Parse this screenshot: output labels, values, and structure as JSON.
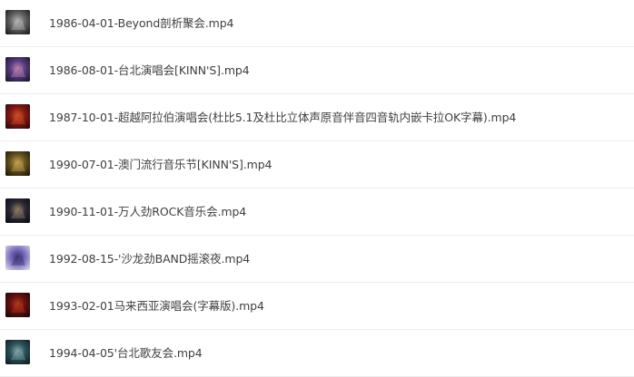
{
  "files": [
    {
      "name": "1986-04-01-Beyond剖析聚会.mp4",
      "thumb_icon": "video-thumbnail-icon",
      "thumb_colors": [
        "#1a1a1a",
        "#6b6b6b",
        "#c9c9c9"
      ]
    },
    {
      "name": "1986-08-01-台北演唱会[KINN'S].mp4",
      "thumb_icon": "video-thumbnail-icon",
      "thumb_colors": [
        "#1b1430",
        "#5a3f86",
        "#d08fb8"
      ]
    },
    {
      "name": "1987-10-01-超越阿拉伯演唱会(杜比5.1及杜比立体声原音伴音四音轨内嵌卡拉OK字幕).mp4",
      "thumb_icon": "video-thumbnail-icon",
      "thumb_colors": [
        "#2a0808",
        "#8e1b14",
        "#e05a2a"
      ]
    },
    {
      "name": "1990-07-01-澳门流行音乐节[KINN'S].mp4",
      "thumb_icon": "video-thumbnail-icon",
      "thumb_colors": [
        "#1c1608",
        "#6e5a22",
        "#d8b45a"
      ]
    },
    {
      "name": "1990-11-01-万人劲ROCK音乐会.mp4",
      "thumb_icon": "video-thumbnail-icon",
      "thumb_colors": [
        "#0b0b10",
        "#2f2d3a",
        "#a08c6e"
      ]
    },
    {
      "name": "1992-08-15-'沙龙劲BAND摇滚夜.mp4",
      "thumb_icon": "video-thumbnail-icon",
      "thumb_colors": [
        "#d9d6ef",
        "#6f63b8",
        "#2a2160"
      ]
    },
    {
      "name": "1993-02-01马来西亚演唱会(字幕版).mp4",
      "thumb_icon": "video-thumbnail-icon",
      "thumb_colors": [
        "#1a0606",
        "#6e1010",
        "#c2401c"
      ]
    },
    {
      "name": "1994-04-05'台北歌友会.mp4",
      "thumb_icon": "video-thumbnail-icon",
      "thumb_colors": [
        "#0e1a1c",
        "#2f5860",
        "#8fb8ba"
      ]
    }
  ]
}
